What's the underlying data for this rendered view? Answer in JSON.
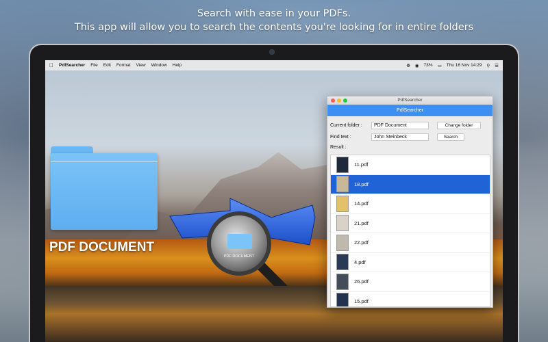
{
  "headline": {
    "line1": "Search with ease in your PDFs.",
    "line2": "This app will allow you to search the contents you're looking for in entire folders"
  },
  "menubar": {
    "apple_icon": "apple-icon",
    "app_name": "PdfSearcher",
    "items": [
      "File",
      "Edit",
      "Format",
      "View",
      "Window",
      "Help"
    ],
    "status": {
      "bluetooth_icon": "bluetooth-icon",
      "wifi_icon": "wifi-icon",
      "battery": "73%",
      "battery_icon": "battery-icon",
      "clock": "Thu 16 Nov  14:29",
      "search_icon": "search-icon",
      "menu_icon": "list-icon"
    }
  },
  "hero": {
    "folder_label": "PDF DOCUMENT",
    "magnifier_label": "PDF DOCUMENT"
  },
  "window": {
    "title": "PdfSearcher",
    "app_title": "PdfSearcher",
    "current_folder_label": "Current folder :",
    "current_folder_value": "PDF Document",
    "change_folder_button": "Change folder",
    "find_text_label": "Find text :",
    "find_text_value": "John Steinbeck",
    "search_button": "Search",
    "result_label": "Result :",
    "results": [
      {
        "name": "11.pdf",
        "thumb": "#1e2a3c",
        "selected": false
      },
      {
        "name": "18.pdf",
        "thumb": "#c9b79a",
        "selected": true
      },
      {
        "name": "14.pdf",
        "thumb": "#e2c16a",
        "selected": false
      },
      {
        "name": "21.pdf",
        "thumb": "#d8d2c8",
        "selected": false
      },
      {
        "name": "22.pdf",
        "thumb": "#bfb9ad",
        "selected": false
      },
      {
        "name": "4.pdf",
        "thumb": "#2a3a55",
        "selected": false
      },
      {
        "name": "26.pdf",
        "thumb": "#444b5a",
        "selected": false
      },
      {
        "name": "15.pdf",
        "thumb": "#22324f",
        "selected": false
      }
    ]
  },
  "colors": {
    "accent": "#3d8ff2",
    "selection": "#1f63d6",
    "folder_blue": "#6bb7f3"
  }
}
